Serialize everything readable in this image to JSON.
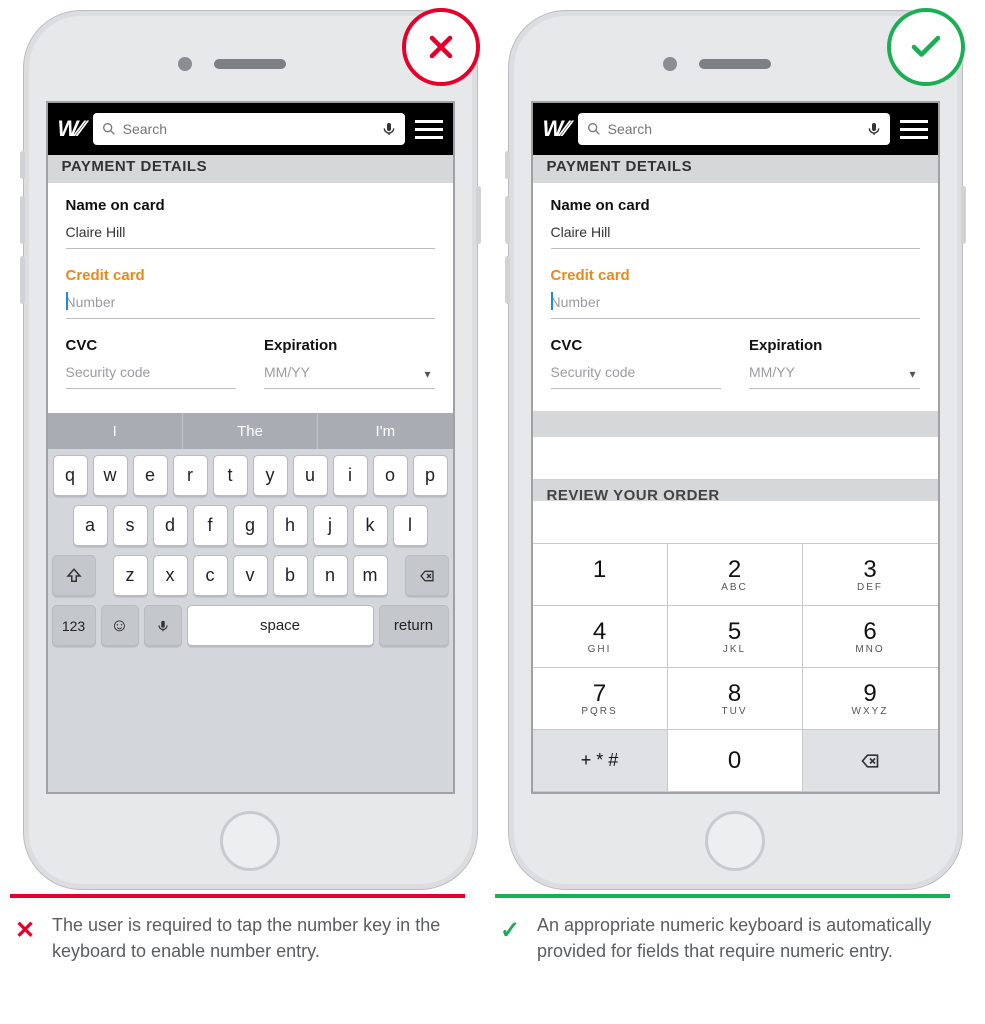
{
  "header": {
    "search_placeholder": "Search",
    "section_title": "PAYMENT DETAILS",
    "review_title": "REVIEW YOUR ORDER"
  },
  "form": {
    "name_label": "Name on card",
    "name_value": "Claire Hill",
    "card_label": "Credit card",
    "card_placeholder": "Number",
    "cvc_label": "CVC",
    "cvc_placeholder": "Security code",
    "exp_label": "Expiration",
    "exp_placeholder": "MM/YY"
  },
  "alpha_kbd": {
    "suggestions": [
      "I",
      "The",
      "I'm"
    ],
    "row1": [
      "q",
      "w",
      "e",
      "r",
      "t",
      "y",
      "u",
      "i",
      "o",
      "p"
    ],
    "row2": [
      "a",
      "s",
      "d",
      "f",
      "g",
      "h",
      "j",
      "k",
      "l"
    ],
    "row3": [
      "z",
      "x",
      "c",
      "v",
      "b",
      "n",
      "m"
    ],
    "numKey": "123",
    "space": "space",
    "ret": "return"
  },
  "num_kbd": {
    "keys": [
      {
        "big": "1",
        "sub": ""
      },
      {
        "big": "2",
        "sub": "ABC"
      },
      {
        "big": "3",
        "sub": "DEF"
      },
      {
        "big": "4",
        "sub": "GHI"
      },
      {
        "big": "5",
        "sub": "JKL"
      },
      {
        "big": "6",
        "sub": "MNO"
      },
      {
        "big": "7",
        "sub": "PQRS"
      },
      {
        "big": "8",
        "sub": "TUV"
      },
      {
        "big": "9",
        "sub": "WXYZ"
      }
    ],
    "sym": "+ * #",
    "zero": "0"
  },
  "captions": {
    "bad": "The user is required to tap the number key in the keyboard to enable number entry.",
    "good": "An appropriate numeric keyboard is automatically provided for fields that require numeric entry."
  }
}
